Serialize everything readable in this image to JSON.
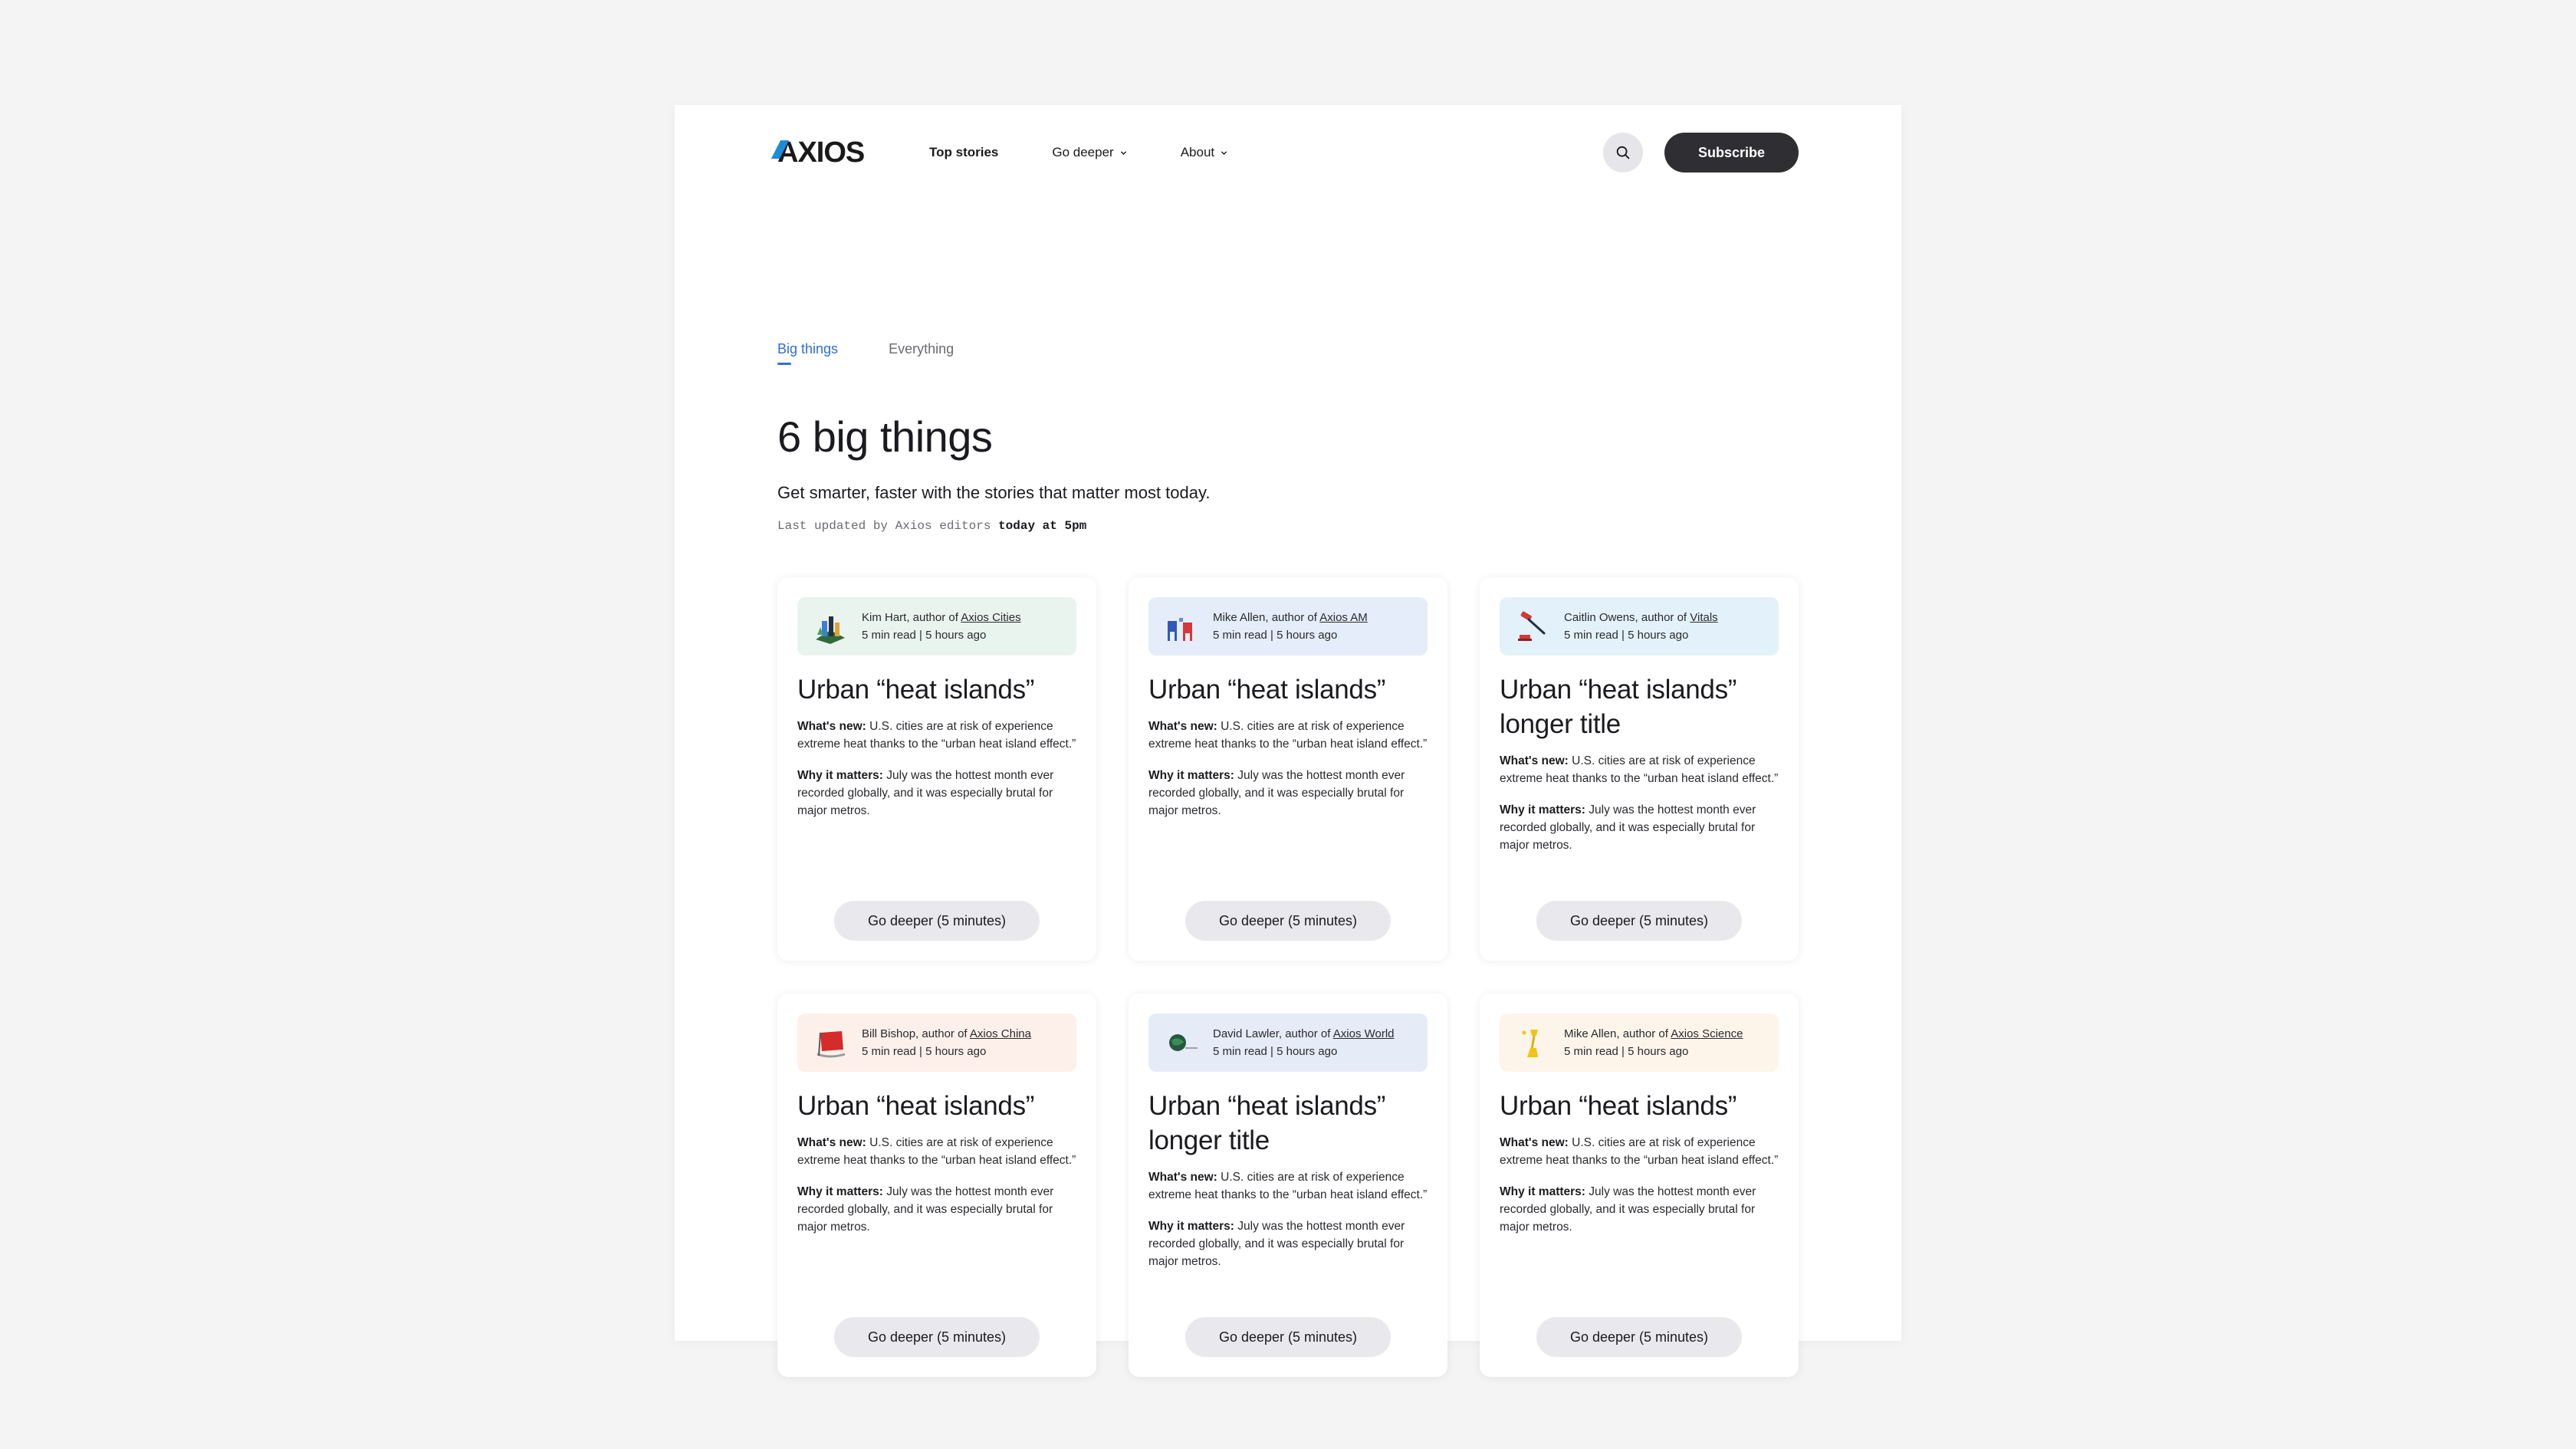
{
  "header": {
    "logo": "AXIOS",
    "nav": [
      {
        "label": "Top stories",
        "dropdown": false
      },
      {
        "label": "Go deeper",
        "dropdown": true
      },
      {
        "label": "About",
        "dropdown": true
      }
    ],
    "search_icon": "search-icon",
    "subscribe_label": "Subscribe",
    "accent": "#1e8bd6"
  },
  "tabs": [
    {
      "label": "Big things",
      "active": true
    },
    {
      "label": "Everything",
      "active": false
    }
  ],
  "hero": {
    "title": "6 big things",
    "subtitle": "Get smarter, faster with the stories that matter most today.",
    "updated_prefix": "Last updated by Axios editors",
    "updated_time": "today at 5pm"
  },
  "cards": [
    {
      "author": "Kim Hart, author of ",
      "newsletter": "Axios Cities",
      "meta": "5 min read | 5 hours ago",
      "tint": "#eaf4ee",
      "icon": "city-illustration-icon",
      "title": "Urban “heat islands”",
      "new_label": "What's new:",
      "new_text": "U.S. cities are at risk of experience extreme heat thanks to the “urban heat island effect.”",
      "why_label": "Why it matters:",
      "why_text": "July was the hottest month ever recorded globally, and it was especially brutal for major metros.",
      "cta": "Go deeper (5 minutes)"
    },
    {
      "author": "Mike Allen, author of ",
      "newsletter": "Axios AM",
      "meta": "5 min read | 5 hours ago",
      "tint": "#e4edf9",
      "icon": "chairs-illustration-icon",
      "title": "Urban “heat islands”",
      "new_label": "What's new:",
      "new_text": "U.S. cities are at risk of experience extreme heat thanks to the “urban heat island effect.”",
      "why_label": "Why it matters:",
      "why_text": "July was the hottest month ever recorded globally, and it was especially brutal for major metros.",
      "cta": "Go deeper (5 minutes)"
    },
    {
      "author": "Caitlin Owens, author of ",
      "newsletter": "Vitals",
      "meta": "5 min read | 5 hours ago",
      "tint": "#e3f2fa",
      "icon": "gavel-illustration-icon",
      "title": "Urban “heat islands” longer title",
      "new_label": "What's new:",
      "new_text": "U.S. cities are at risk of experience extreme heat thanks to the “urban heat island effect.”",
      "why_label": "Why it matters:",
      "why_text": "July was the hottest month ever recorded globally, and it was especially brutal for major metros.",
      "cta": "Go deeper (5 minutes)"
    },
    {
      "author": "Bill Bishop, author of ",
      "newsletter": "Axios China",
      "meta": "5 min read | 5 hours ago",
      "tint": "#fdf0ea",
      "icon": "flag-illustration-icon",
      "title": "Urban “heat islands”",
      "new_label": "What's new:",
      "new_text": "U.S. cities are at risk of experience extreme heat thanks to the “urban heat island effect.”",
      "why_label": "Why it matters:",
      "why_text": "July was the hottest month ever recorded globally, and it was especially brutal for major metros.",
      "cta": "Go deeper (5 minutes)"
    },
    {
      "author": "David Lawler, author of ",
      "newsletter": "Axios World",
      "meta": "5 min read | 5 hours ago",
      "tint": "#e6ebf8",
      "icon": "globe-illustration-icon",
      "title": "Urban “heat islands” longer title",
      "new_label": "What's new:",
      "new_text": "U.S. cities are at risk of experience extreme heat thanks to the “urban heat island effect.”",
      "why_label": "Why it matters:",
      "why_text": "July was the hottest month ever recorded globally, and it was especially brutal for major metros.",
      "cta": "Go deeper (5 minutes)"
    },
    {
      "author": "Mike Allen, author of ",
      "newsletter": "Axios Science",
      "meta": "5 min read | 5 hours ago",
      "tint": "#fdf5ea",
      "icon": "lamp-illustration-icon",
      "title": "Urban “heat islands”",
      "new_label": "What's new:",
      "new_text": "U.S. cities are at risk of experience extreme heat thanks to the “urban heat island effect.”",
      "why_label": "Why it matters:",
      "why_text": "July was the hottest month ever recorded globally, and it was especially brutal for major metros.",
      "cta": "Go deeper (5 minutes)"
    }
  ]
}
